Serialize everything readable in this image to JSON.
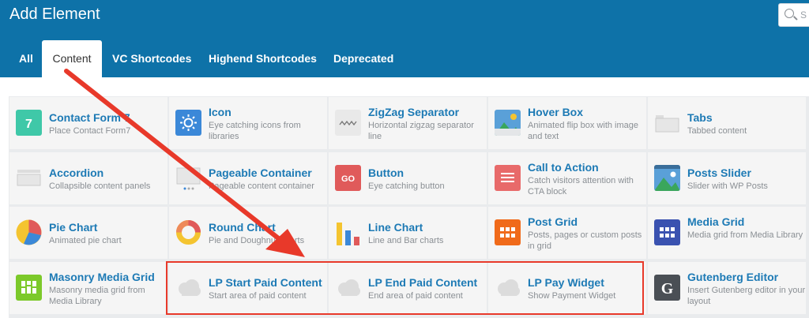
{
  "header": {
    "title": "Add Element",
    "search_placeholder": "S"
  },
  "tabs": [
    {
      "label": "All"
    },
    {
      "label": "Content"
    },
    {
      "label": "VC Shortcodes"
    },
    {
      "label": "Highend Shortcodes"
    },
    {
      "label": "Deprecated"
    }
  ],
  "elements": [
    {
      "name": "Contact Form 7",
      "desc": "Place Contact Form7",
      "icon": "contact-form-icon"
    },
    {
      "name": "Icon",
      "desc": "Eye catching icons from libraries",
      "icon": "sun-icon"
    },
    {
      "name": "ZigZag Separator",
      "desc": "Horizontal zigzag separator line",
      "icon": "zigzag-icon"
    },
    {
      "name": "Hover Box",
      "desc": "Animated flip box with image and text",
      "icon": "hover-box-icon"
    },
    {
      "name": "Tabs",
      "desc": "Tabbed content",
      "icon": "tabs-icon"
    },
    {
      "name": "Accordion",
      "desc": "Collapsible content panels",
      "icon": "accordion-icon"
    },
    {
      "name": "Pageable Container",
      "desc": "Pageable content container",
      "icon": "pageable-icon"
    },
    {
      "name": "Button",
      "desc": "Eye catching button",
      "icon": "go-button-icon"
    },
    {
      "name": "Call to Action",
      "desc": "Catch visitors attention with CTA block",
      "icon": "call-to-action-icon"
    },
    {
      "name": "Posts Slider",
      "desc": "Slider with WP Posts",
      "icon": "posts-slider-icon"
    },
    {
      "name": "Pie Chart",
      "desc": "Animated pie chart",
      "icon": "pie-chart-icon"
    },
    {
      "name": "Round Chart",
      "desc": "Pie and Doughnut charts",
      "icon": "round-chart-icon"
    },
    {
      "name": "Line Chart",
      "desc": "Line and Bar charts",
      "icon": "line-chart-icon"
    },
    {
      "name": "Post Grid",
      "desc": "Posts, pages or custom posts in grid",
      "icon": "post-grid-icon"
    },
    {
      "name": "Media Grid",
      "desc": "Media grid from Media Library",
      "icon": "media-grid-icon"
    },
    {
      "name": "Masonry Media Grid",
      "desc": "Masonry media grid from Media Library",
      "icon": "masonry-grid-icon"
    },
    {
      "name": "LP Start Paid Content",
      "desc": "Start area of paid content",
      "icon": "cloud-icon"
    },
    {
      "name": "LP End Paid Content",
      "desc": "End area of paid content",
      "icon": "cloud-icon"
    },
    {
      "name": "LP Pay Widget",
      "desc": "Show Payment Widget",
      "icon": "cloud-icon"
    },
    {
      "name": "Gutenberg Editor",
      "desc": "Insert Gutenberg editor in your layout",
      "icon": "gutenberg-icon"
    }
  ]
}
